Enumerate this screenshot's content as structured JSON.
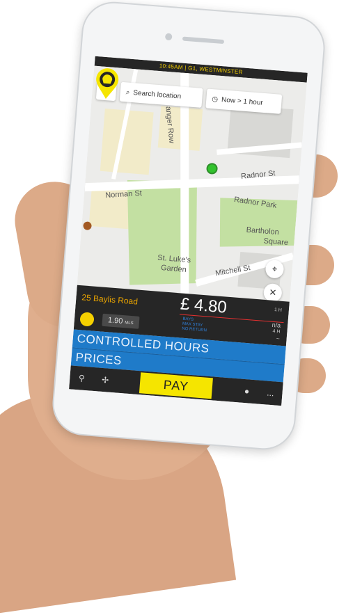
{
  "status_bar": {
    "text": "10:45AM | G1, WESTMINSTER"
  },
  "toolbar": {
    "search_label": "Search location",
    "time_label": "Now > 1 hour"
  },
  "map": {
    "street_labels": [
      "Norman St",
      "Radnor St",
      "Radnor Park",
      "Bartholon",
      "Square",
      "St. Luke's",
      "Garden",
      "Mitchell St",
      "anger Row"
    ]
  },
  "bay": {
    "address": "25 Baylis Road",
    "price": "£ 4.80",
    "duration": "1 H",
    "distance_value": "1.90",
    "distance_unit": "MLS",
    "rules": [
      "BAYS",
      "MAX STAY",
      "NO RETURN"
    ],
    "rule_values": [
      "n/a",
      "4 H",
      "--"
    ]
  },
  "sections": {
    "controlled_hours": "CONTROLLED HOURS",
    "prices": "PRICES"
  },
  "nav": {
    "pay": "PAY",
    "more": "..."
  },
  "colors": {
    "accent_yellow": "#f5e500",
    "band_blue": "#1f7bc9",
    "address_orange": "#e8a300"
  },
  "icons": [
    "menu-icon",
    "search-icon",
    "clock-icon",
    "parking-meter-pin-icon",
    "locate-icon",
    "close-icon",
    "route-icon",
    "directions-icon",
    "map-pin-icon"
  ]
}
